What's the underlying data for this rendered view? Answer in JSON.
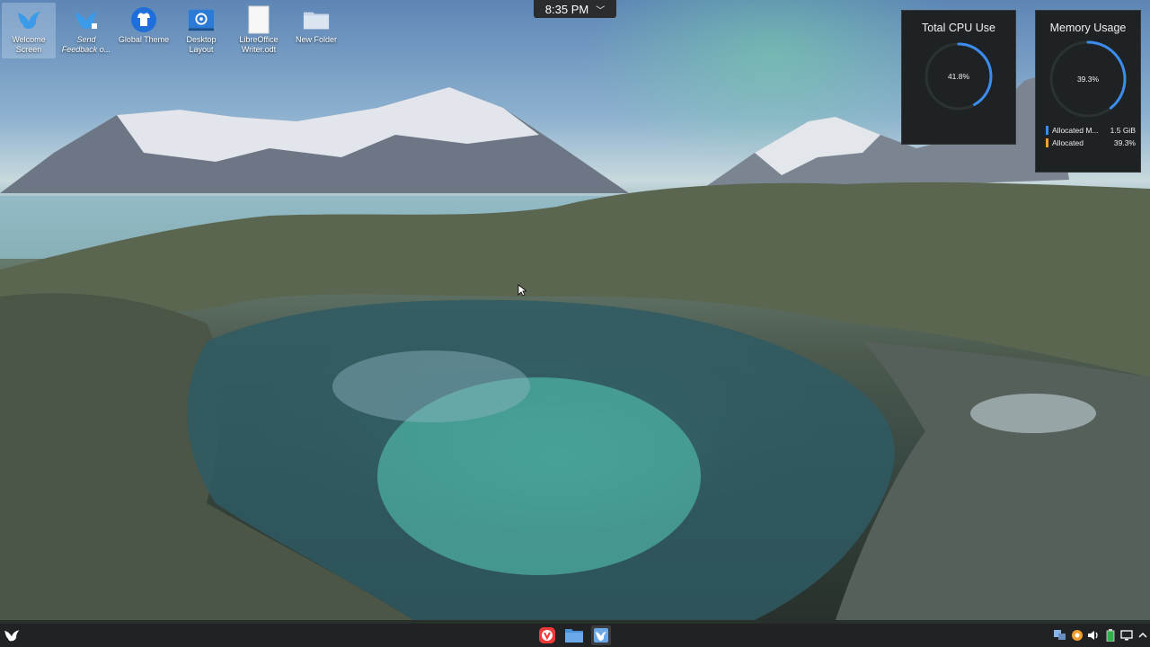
{
  "desktop": {
    "icons": [
      {
        "label": "Welcome Screen",
        "icon": "bird-logo-icon"
      },
      {
        "label": "Send Feedback o...",
        "icon": "bird-feedback-icon"
      },
      {
        "label": "Global Theme",
        "icon": "shirt-theme-icon"
      },
      {
        "label": "Desktop Layout",
        "icon": "layout-icon"
      },
      {
        "label": "LibreOffice Writer.odt",
        "icon": "document-icon"
      },
      {
        "label": "New Folder",
        "icon": "folder-icon"
      }
    ]
  },
  "clock": {
    "time": "8:35 PM",
    "chevron": "﹀"
  },
  "widgets": {
    "cpu": {
      "title": "Total CPU Use",
      "value_label": "41.8%",
      "value": 41.8,
      "color": "#3b8df0"
    },
    "memory": {
      "title": "Memory Usage",
      "value_label": "39.3%",
      "value": 39.3,
      "color": "#3b8df0",
      "legend": [
        {
          "label": "Allocated M...",
          "value": "1.5 GiB",
          "color": "#3b8df0"
        },
        {
          "label": "Allocated",
          "value": "39.3%",
          "color": "#f0a030"
        }
      ]
    }
  },
  "taskbar": {
    "launcher": "bird-menu-icon",
    "apps": [
      {
        "name": "vivaldi-browser-icon",
        "color": "#ef3939"
      },
      {
        "name": "file-manager-icon",
        "color": "#4a90d9"
      },
      {
        "name": "welcome-app-icon",
        "color": "#6aa8e8"
      }
    ],
    "tray": [
      "network-icon",
      "updates-icon",
      "volume-icon",
      "battery-icon",
      "display-icon",
      "tray-expand-icon"
    ]
  }
}
